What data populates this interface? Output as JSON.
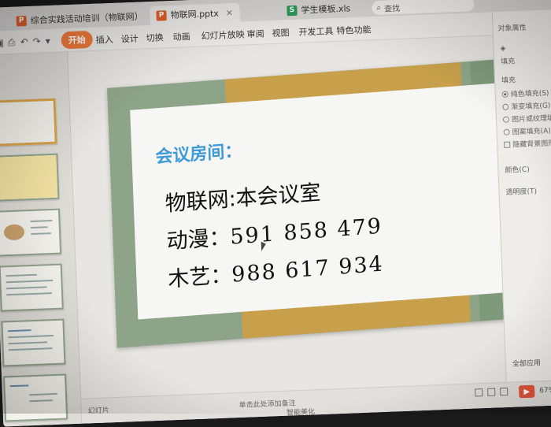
{
  "tabs": [
    {
      "icon": "P",
      "label": "综合实践活动培训（物联网）"
    },
    {
      "icon": "P",
      "label": "物联网.pptx"
    },
    {
      "icon": "S",
      "label": "学生模板.xls"
    }
  ],
  "search": {
    "label": "查找"
  },
  "menu": {
    "items": [
      "开始",
      "插入",
      "设计",
      "切换",
      "动画",
      "幻灯片放映",
      "审阅",
      "视图",
      "开发工具",
      "特色功能"
    ],
    "active_index": 0
  },
  "slide": {
    "title": "会议房间：",
    "lines": [
      {
        "label": "物联网:",
        "value": "本会议室"
      },
      {
        "label": "动漫：",
        "value": "591 858 479"
      },
      {
        "label": "木艺：",
        "value": "988 617 934"
      }
    ]
  },
  "right_pane": {
    "title": "对象属性",
    "tab": "填充",
    "section": "填充",
    "options": [
      "纯色填充(S)",
      "渐变填充(G)",
      "图片或纹理填充",
      "图案填充(A)"
    ],
    "checkbox_label": "隐藏背景图形",
    "color_label": "颜色(C)",
    "transparency_label": "透明度(T)",
    "apply_all_label": "全部应用"
  },
  "status": {
    "left": "幻灯片",
    "notes": "单击此处添加备注",
    "bottom_text": "智能美化",
    "zoom": "67%"
  },
  "colors": {
    "accent": "#f07a3a",
    "slide_title": "#3d9ad6",
    "slide_green": "#8ea488",
    "slide_gold": "#c8a04b"
  }
}
